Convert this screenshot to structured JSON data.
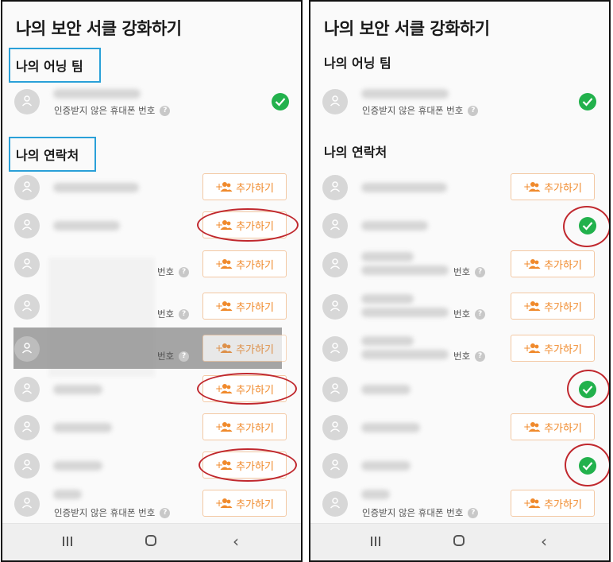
{
  "header": {
    "title": "나의 보안 서클 강화하기"
  },
  "owning_team": {
    "label": "나의 어닝 팀"
  },
  "contacts": {
    "label": "나의 연락처"
  },
  "owner_row": {
    "sub_label": "인증받지 않은 휴대폰 번호",
    "help": "?"
  },
  "add_label": "추가하기",
  "partial_phone": "번호",
  "last_sub_label": "인증받지 않은 휴대폰 번호",
  "nav": {
    "recents": "recents-icon",
    "home": "home-icon",
    "back": "‹"
  },
  "colors": {
    "accent": "#f08a2c",
    "check": "#22b14c",
    "annotation_box": "#2aa0d8",
    "annotation_ellipse": "#c0282e"
  }
}
